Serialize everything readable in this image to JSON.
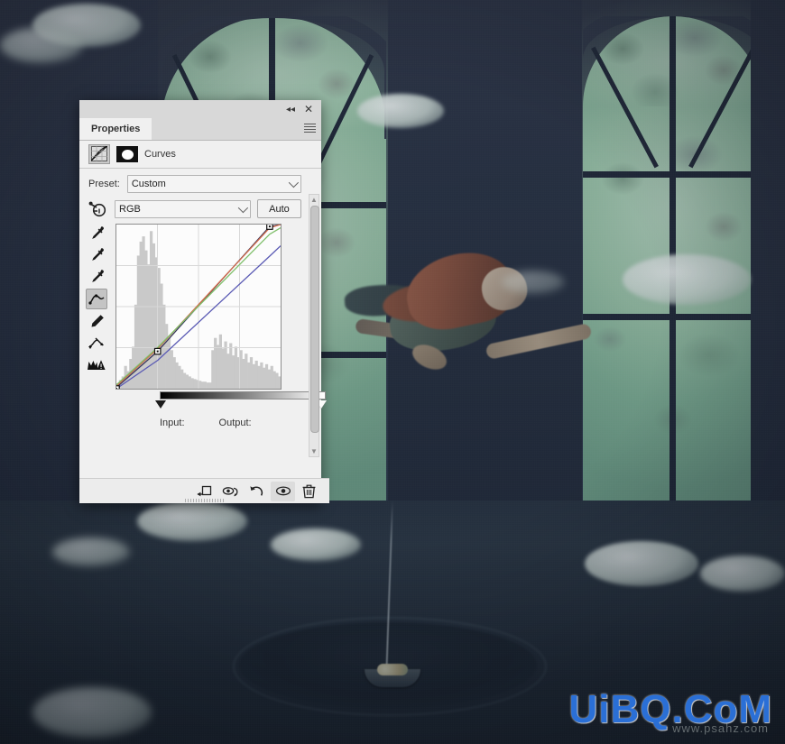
{
  "panel": {
    "tab_label": "Properties",
    "collapse_icon": "collapse-double-left-icon",
    "close_icon": "close-icon",
    "menu_icon": "panel-menu-icon",
    "adjustment_title": "Curves",
    "preset_label": "Preset:",
    "preset_value": "Custom",
    "channel_value": "RGB",
    "auto_label": "Auto",
    "input_label": "Input:",
    "output_label": "Output:",
    "input_value": "",
    "output_value": "",
    "tools": [
      {
        "name": "target-adjustment-tool",
        "title": "On-image adjustment"
      },
      {
        "name": "black-point-eyedropper",
        "title": "Sample in image to set black point"
      },
      {
        "name": "gray-point-eyedropper",
        "title": "Sample in image to set gray point"
      },
      {
        "name": "white-point-eyedropper",
        "title": "Sample in image to set white point"
      },
      {
        "name": "curve-point-tool",
        "title": "Edit points to modify the curve"
      },
      {
        "name": "pencil-tool",
        "title": "Draw to modify the curve"
      },
      {
        "name": "smooth-curve-tool",
        "title": "Smooth the curve values"
      },
      {
        "name": "clipping-warning-tool",
        "title": "Show clipping"
      }
    ],
    "active_tool": "curve-point-tool",
    "footer_buttons": [
      {
        "name": "clip-to-layer-button",
        "label": "Clip to layer"
      },
      {
        "name": "preview-toggle-button",
        "label": "Toggle layer visibility of previous state"
      },
      {
        "name": "reset-button",
        "label": "Reset to adjustment defaults"
      },
      {
        "name": "visibility-button",
        "label": "Toggle layer visibility"
      },
      {
        "name": "delete-button",
        "label": "Delete this adjustment layer"
      }
    ],
    "active_footer_button": "visibility-button",
    "scrollbar": {
      "up_arrow": "chevron-up-icon",
      "down_arrow": "chevron-down-icon"
    }
  },
  "colors": {
    "panel_bg": "#f0f0f0",
    "panel_header": "#d8d8d8",
    "graph_bg": "#fcfcfc",
    "curve_composite": "#3a3a5c",
    "curve_red": "#d06a4a",
    "curve_green": "#7fbf6a",
    "curve_blue": "#5a5ab4",
    "watermark_blue": "#2a6fd6",
    "window_green": "#9cc7a8"
  },
  "chart_data": {
    "type": "line",
    "title": "Curves",
    "xlabel": "Input",
    "ylabel": "Output",
    "xlim": [
      0,
      255
    ],
    "ylim": [
      0,
      255
    ],
    "grid": true,
    "grid_divisions": 4,
    "legend": "none",
    "control_points": [
      {
        "channel": "composite",
        "input": 0,
        "output": 0
      },
      {
        "channel": "composite",
        "input": 64,
        "output": 58
      },
      {
        "channel": "composite",
        "input": 238,
        "output": 252
      }
    ],
    "series": [
      {
        "name": "Composite (RGB)",
        "color": "#3a3a5c",
        "points": [
          [
            0,
            2
          ],
          [
            64,
            58
          ],
          [
            238,
            252
          ],
          [
            255,
            255
          ]
        ]
      },
      {
        "name": "Red",
        "color": "#d06a4a",
        "points": [
          [
            0,
            4
          ],
          [
            64,
            62
          ],
          [
            238,
            250
          ],
          [
            255,
            255
          ]
        ]
      },
      {
        "name": "Green",
        "color": "#7fbf6a",
        "points": [
          [
            0,
            6
          ],
          [
            64,
            64
          ],
          [
            238,
            240
          ],
          [
            255,
            250
          ]
        ]
      },
      {
        "name": "Blue",
        "color": "#5a5ab4",
        "points": [
          [
            0,
            0
          ],
          [
            64,
            44
          ],
          [
            238,
            206
          ],
          [
            255,
            222
          ]
        ]
      }
    ],
    "histogram": {
      "bins": 64,
      "values": [
        6,
        10,
        14,
        26,
        20,
        34,
        48,
        96,
        152,
        168,
        174,
        158,
        142,
        180,
        166,
        150,
        138,
        120,
        96,
        74,
        58,
        44,
        36,
        30,
        26,
        22,
        18,
        16,
        14,
        12,
        11,
        10,
        9,
        8,
        8,
        7,
        7,
        44,
        58,
        50,
        62,
        46,
        54,
        40,
        52,
        38,
        48,
        36,
        44,
        34,
        40,
        30,
        36,
        28,
        32,
        26,
        30,
        24,
        28,
        22,
        26,
        20,
        18,
        14
      ]
    },
    "black_slider": 0,
    "white_slider": 255
  },
  "watermark": {
    "main": "UiBQ.CoM",
    "sub": "www.psahz.com"
  }
}
